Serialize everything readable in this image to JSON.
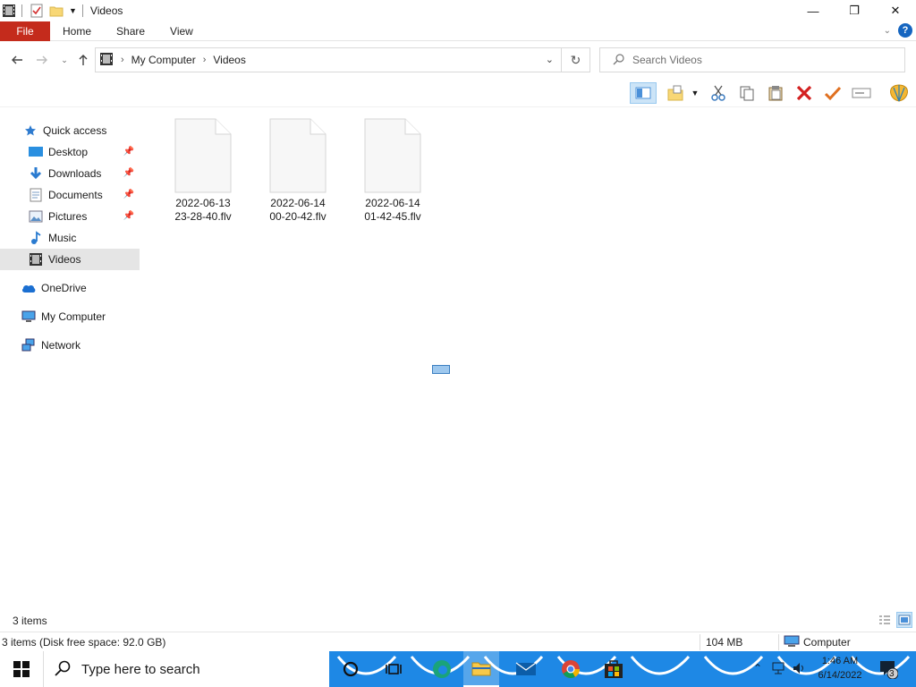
{
  "window": {
    "title": "Videos",
    "controls": {
      "minimize": "—",
      "maximize": "❐",
      "close": "✕"
    }
  },
  "ribbon": {
    "tabs": [
      "File",
      "Home",
      "Share",
      "View"
    ],
    "help": "?"
  },
  "address": {
    "crumbs": [
      "My Computer",
      "Videos"
    ],
    "search_placeholder": "Search Videos"
  },
  "sidebar": {
    "quick_access": "Quick access",
    "items": [
      {
        "label": "Desktop",
        "icon": "desktop-icon",
        "pinned": true
      },
      {
        "label": "Downloads",
        "icon": "downloads-icon",
        "pinned": true
      },
      {
        "label": "Documents",
        "icon": "documents-icon",
        "pinned": true
      },
      {
        "label": "Pictures",
        "icon": "pictures-icon",
        "pinned": true
      },
      {
        "label": "Music",
        "icon": "music-icon",
        "pinned": false
      },
      {
        "label": "Videos",
        "icon": "videos-icon",
        "pinned": false,
        "selected": true
      }
    ],
    "onedrive": "OneDrive",
    "computer": "My Computer",
    "network": "Network"
  },
  "files": [
    {
      "line1": "2022-06-13",
      "line2": "23-28-40.flv"
    },
    {
      "line1": "2022-06-14",
      "line2": "00-20-42.flv"
    },
    {
      "line1": "2022-06-14",
      "line2": "01-42-45.flv"
    }
  ],
  "status": {
    "item_count": "3 items",
    "disk_info": "3 items (Disk free space: 92.0 GB)",
    "size": "104 MB",
    "location": "Computer"
  },
  "taskbar": {
    "search_placeholder": "Type here to search",
    "time": "1:46 AM",
    "date": "6/14/2022",
    "notifications": "3"
  },
  "colors": {
    "file_tab": "#c42b1c",
    "taskbar": "#1e88e5",
    "selection": "#e5e5e5"
  }
}
